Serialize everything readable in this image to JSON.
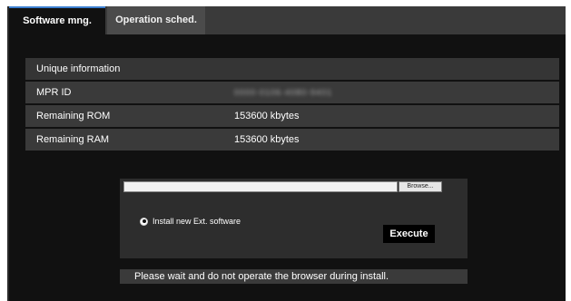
{
  "tabs": [
    {
      "label": "Software mng.",
      "active": true
    },
    {
      "label": "Operation sched.",
      "active": false
    }
  ],
  "info": {
    "header": "Unique information",
    "rows": [
      {
        "label": "MPR ID",
        "value": "0000-0106-4080-9401",
        "blurred": true
      },
      {
        "label": "Remaining ROM",
        "value": "153600 kbytes"
      },
      {
        "label": "Remaining RAM",
        "value": "153600 kbytes"
      }
    ]
  },
  "install": {
    "browse_label": "Browse...",
    "file_value": "",
    "radio_label": "Install new Ext. software",
    "radio_checked": true,
    "execute_label": "Execute"
  },
  "notice": "Please wait and do not operate the browser during install.",
  "colors": {
    "background": "#111111",
    "tab_accent": "#3c7fd0",
    "row_bg": "#3a3a3a"
  }
}
